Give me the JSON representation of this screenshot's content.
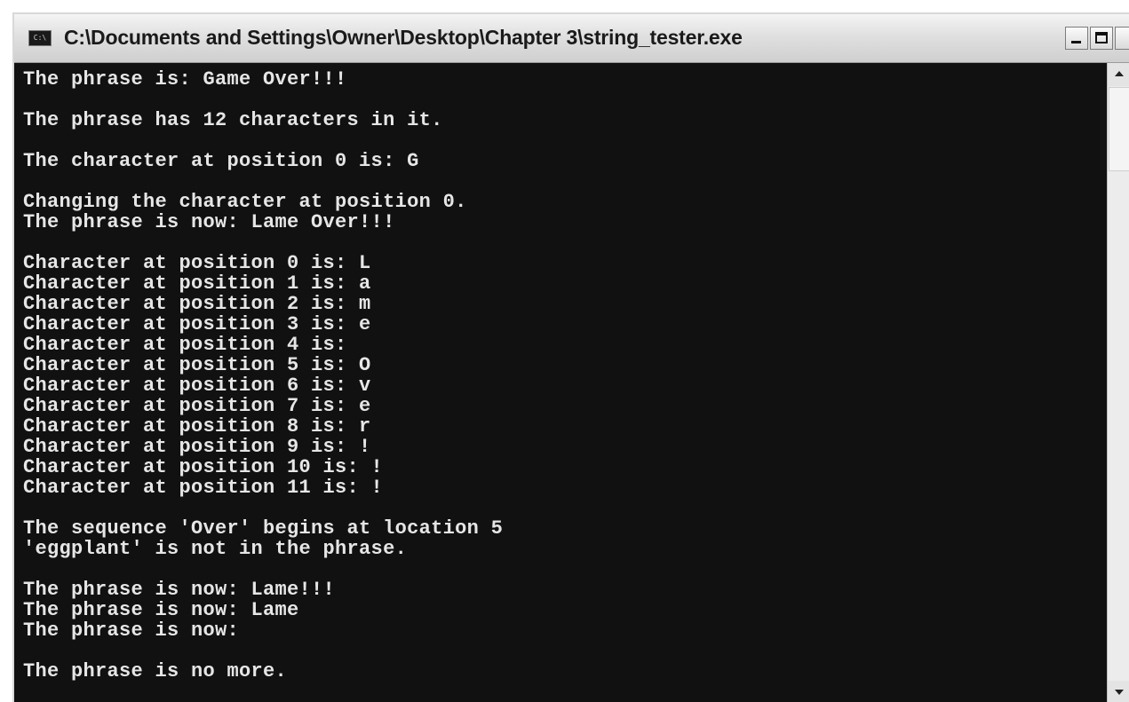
{
  "window": {
    "title": "C:\\Documents and Settings\\Owner\\Desktop\\Chapter 3\\string_tester.exe",
    "app_icon_label": "C:\\",
    "app_icon": "console-app-icon",
    "titlebar_buttons": [
      "minimize-icon",
      "maximize-icon"
    ]
  },
  "console": {
    "lines": [
      "The phrase is: Game Over!!!",
      "",
      "The phrase has 12 characters in it.",
      "",
      "The character at position 0 is: G",
      "",
      "Changing the character at position 0.",
      "The phrase is now: Lame Over!!!",
      "",
      "Character at position 0 is: L",
      "Character at position 1 is: a",
      "Character at position 2 is: m",
      "Character at position 3 is: e",
      "Character at position 4 is:",
      "Character at position 5 is: O",
      "Character at position 6 is: v",
      "Character at position 7 is: e",
      "Character at position 8 is: r",
      "Character at position 9 is: !",
      "Character at position 10 is: !",
      "Character at position 11 is: !",
      "",
      "The sequence 'Over' begins at location 5",
      "'eggplant' is not in the phrase.",
      "",
      "The phrase is now: Lame!!!",
      "The phrase is now: Lame",
      "The phrase is now:",
      "",
      "The phrase is no more."
    ]
  },
  "scrollbar": {
    "up_icon": "scroll-up-arrow-icon",
    "down_icon": "scroll-down-arrow-icon"
  },
  "colors": {
    "console_background": "#111111",
    "console_text": "#e6e6e6",
    "titlebar": "#e0e0e0"
  }
}
